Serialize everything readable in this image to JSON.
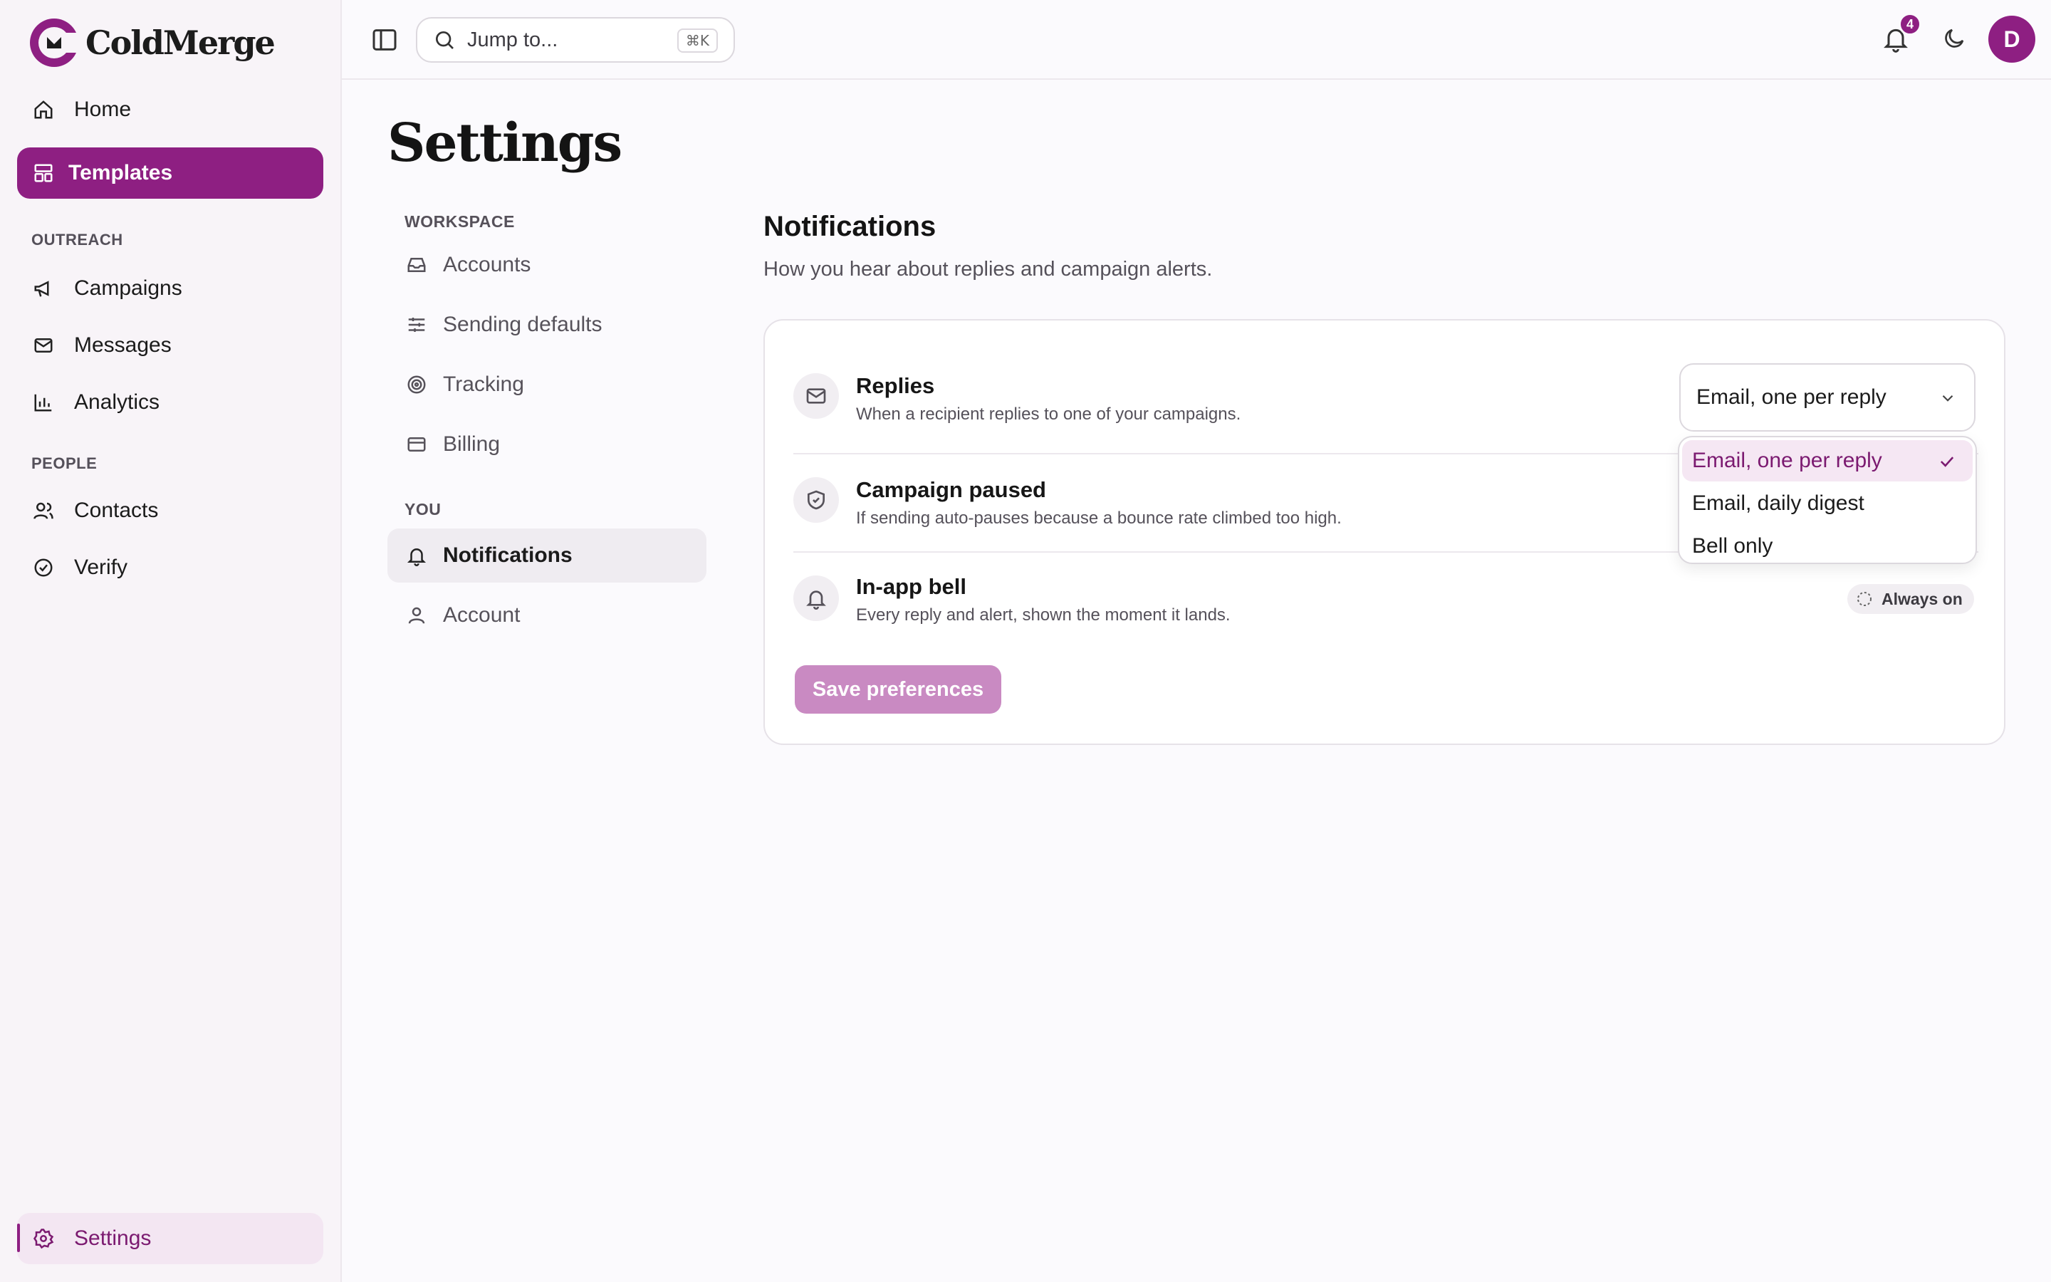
{
  "app": {
    "name": "ColdMerge",
    "accent": "#8e1f82"
  },
  "sidebar": {
    "items": [
      {
        "label": "Home",
        "icon": "home-icon"
      },
      {
        "label": "Templates",
        "icon": "layout-icon"
      }
    ],
    "sections": [
      {
        "title": "OUTREACH",
        "items": [
          {
            "label": "Campaigns",
            "icon": "megaphone-icon"
          },
          {
            "label": "Messages",
            "icon": "mail-icon"
          },
          {
            "label": "Analytics",
            "icon": "bar-chart-icon"
          }
        ]
      },
      {
        "title": "PEOPLE",
        "items": [
          {
            "label": "Contacts",
            "icon": "users-icon"
          },
          {
            "label": "Verify",
            "icon": "check-circle-icon"
          }
        ]
      }
    ],
    "footer": {
      "label": "Settings",
      "icon": "gear-icon"
    }
  },
  "topbar": {
    "search_placeholder": "Jump to...",
    "shortcut": "⌘K",
    "notification_count": "4",
    "avatar_initial": "D"
  },
  "page": {
    "title": "Settings",
    "subnav": {
      "workspace_title": "WORKSPACE",
      "workspace_items": [
        "Accounts",
        "Sending defaults",
        "Tracking",
        "Billing"
      ],
      "you_title": "YOU",
      "you_items": [
        "Notifications",
        "Account"
      ]
    },
    "section": {
      "title": "Notifications",
      "description": "How you hear about replies and campaign alerts.",
      "rows": [
        {
          "title": "Replies",
          "description": "When a recipient replies to one of your campaigns."
        },
        {
          "title": "Campaign paused",
          "description": "If sending auto-pauses because a bounce rate climbed too high."
        },
        {
          "title": "In-app bell",
          "description": "Every reply and alert, shown the moment it lands."
        }
      ],
      "replies_select_value": "Email, one per reply",
      "always_on_label": "Always on",
      "save_label": "Save preferences"
    },
    "dropdown": {
      "options": [
        "Email, one per reply",
        "Email, daily digest",
        "Bell only"
      ],
      "selected": "Email, one per reply"
    }
  }
}
